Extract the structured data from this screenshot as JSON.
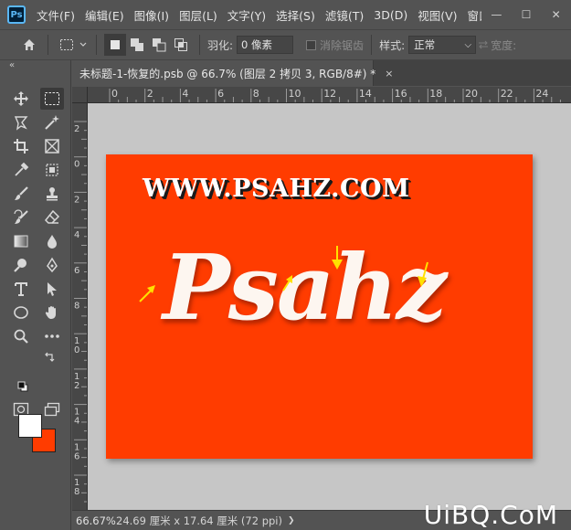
{
  "app": {
    "logo": "Ps"
  },
  "menu": [
    "文件(F)",
    "编辑(E)",
    "图像(I)",
    "图层(L)",
    "文字(Y)",
    "选择(S)",
    "滤镜(T)",
    "3D(D)",
    "视图(V)",
    "窗口W"
  ],
  "window_controls": [
    "—",
    "☐",
    "✕"
  ],
  "options_bar": {
    "feather_label": "羽化:",
    "feather_value": "0 像素",
    "antialias_label": "消除锯齿",
    "style_label": "样式:",
    "style_value": "正常",
    "width_label": "宽度:"
  },
  "toolbar": {
    "collapse": "«"
  },
  "document_tab": {
    "title": "未标题-1-恢复的.psb @ 66.7% (图层 2 拷贝 3, RGB/8#) *",
    "close": "×"
  },
  "ruler": {
    "top_labels": [
      "0",
      "2",
      "4",
      "6",
      "8",
      "10",
      "12",
      "14",
      "16",
      "18",
      "20",
      "22",
      "24"
    ],
    "left_labels": [
      "2",
      "0",
      "2",
      "4",
      "6",
      "8",
      "10",
      "12",
      "14",
      "16",
      "18"
    ]
  },
  "canvas": {
    "background_color": "#ff3c00",
    "url_text": "WWW.PSAHZ.COM",
    "logo_text": "Psahz"
  },
  "status": {
    "zoom": "66.67%",
    "doc_info": "24.69 厘米 x 17.64 厘米 (72 ppi)",
    "caret": "❯"
  },
  "watermark": "UiBQ.CoM",
  "colors": {
    "foreground": "#ffffff",
    "background": "#ff3c00",
    "arrow": "#ffe100"
  }
}
